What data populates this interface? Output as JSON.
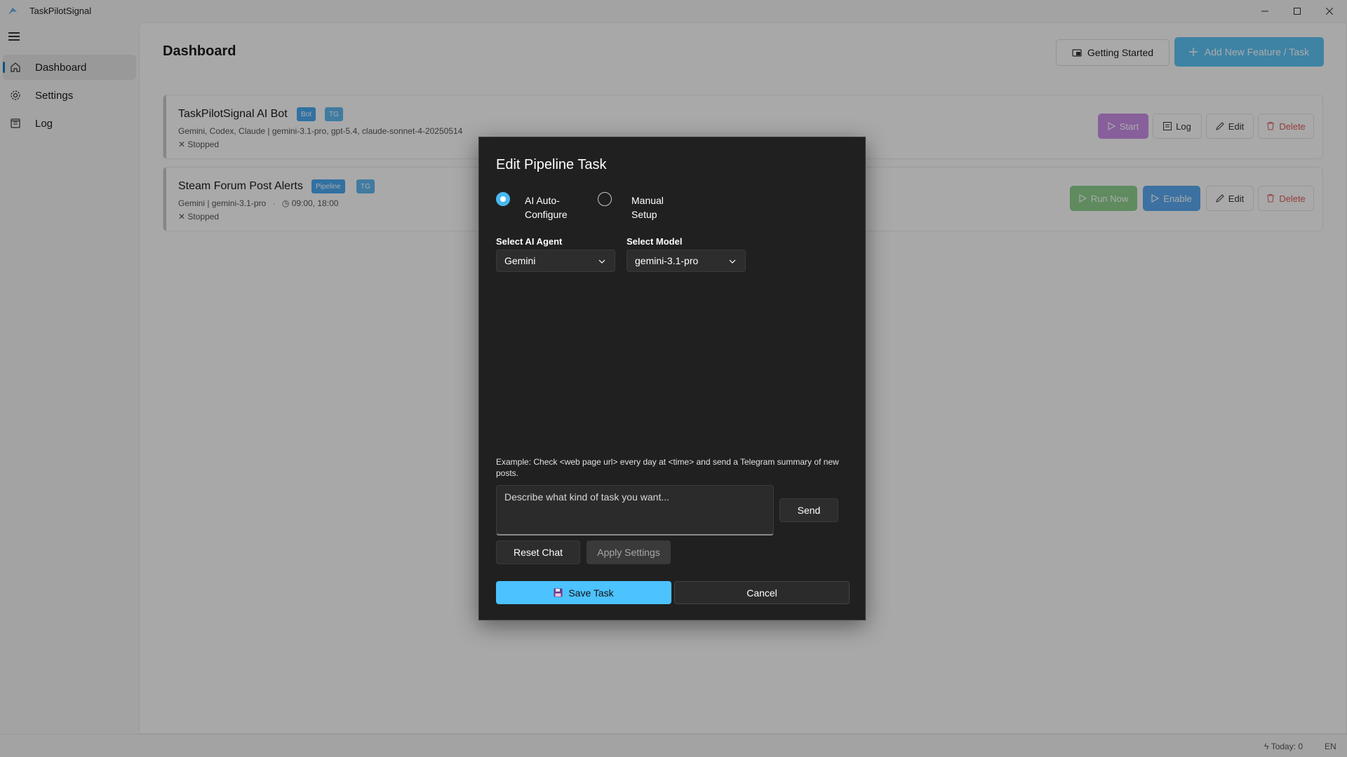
{
  "app": {
    "title": "TaskPilotSignal"
  },
  "sidebar": {
    "items": [
      {
        "label": "Dashboard",
        "icon": "home-icon",
        "active": true
      },
      {
        "label": "Settings",
        "icon": "gear-icon"
      },
      {
        "label": "Log",
        "icon": "log-icon"
      }
    ]
  },
  "header": {
    "title": "Dashboard",
    "getting_started": "Getting Started",
    "add_task": "Add New Feature / Task"
  },
  "tasks": [
    {
      "title": "TaskPilotSignal AI Bot",
      "badges": [
        "Bot",
        "TG"
      ],
      "meta": "Gemini, Codex, Claude | gemini-3.1-pro, gpt-5.4, claude-sonnet-4-20250514",
      "status": "Stopped",
      "actions": [
        "Start",
        "Log",
        "Edit",
        "Delete"
      ]
    },
    {
      "title": "Steam Forum Post Alerts",
      "badges": [
        "Pipeline",
        "TG"
      ],
      "meta": "Gemini | gemini-3.1-pro",
      "schedule": "09:00, 18:00",
      "status": "Stopped",
      "actions": [
        "Run Now",
        "Enable",
        "Edit",
        "Delete"
      ]
    }
  ],
  "status_bar": {
    "today": "Today: 0",
    "lang": "EN"
  },
  "modal": {
    "title": "Edit Pipeline Task",
    "mode_options": [
      {
        "label": "AI Auto-\nConfigure",
        "selected": true
      },
      {
        "label": "Manual\nSetup",
        "selected": false
      }
    ],
    "agent_label": "Select AI Agent",
    "agent_value": "Gemini",
    "model_label": "Select Model",
    "model_value": "gemini-3.1-pro",
    "example": "Example: Check <web page url> every day at <time> and send a Telegram summary of new posts.",
    "input_placeholder": "Describe what kind of task you want...",
    "send": "Send",
    "reset_chat": "Reset Chat",
    "apply_settings": "Apply Settings",
    "save": "Save Task",
    "cancel": "Cancel"
  },
  "colors": {
    "accent": "#4cc2ff",
    "modal_bg": "#202020",
    "start": "#c98ee8",
    "run_now": "#8ed08e",
    "enable": "#5aa9f0",
    "delete": "#e05a5a",
    "badge_bot": "#4aa9f0",
    "badge_tg": "#60b8f0",
    "badge_pipeline": "#4aa9f0"
  }
}
